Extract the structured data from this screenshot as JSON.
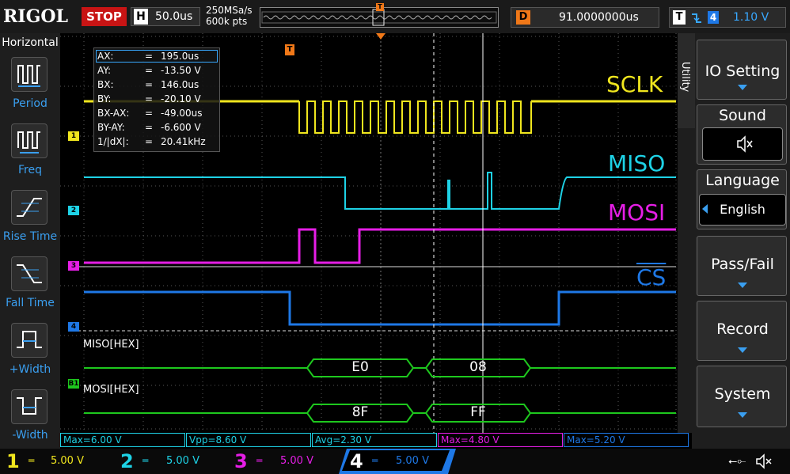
{
  "topbar": {
    "brand": "RIGOL",
    "run_state": "STOP",
    "horizontal_letter": "H",
    "timebase": "50.0us",
    "sample_rate": "250MSa/s",
    "memory_depth": "600k pts",
    "delay_letter": "D",
    "delay": "91.0000000us",
    "trigger_letter": "T",
    "trigger_channel": "4",
    "trigger_level": "1.10 V",
    "trigger_marker": "T"
  },
  "left_panel": {
    "title": "Horizontal",
    "items": [
      {
        "label": "Period",
        "icon": "period-icon"
      },
      {
        "label": "Freq",
        "icon": "freq-icon"
      },
      {
        "label": "Rise Time",
        "icon": "rise-time-icon"
      },
      {
        "label": "Fall Time",
        "icon": "fall-time-icon"
      },
      {
        "label": "+Width",
        "icon": "positive-width-icon"
      },
      {
        "label": "-Width",
        "icon": "negative-width-icon"
      }
    ]
  },
  "cursor_readout": {
    "rows": [
      {
        "name": "AX:",
        "value": "195.0us"
      },
      {
        "name": "AY:",
        "value": "-13.50 V"
      },
      {
        "name": "BX:",
        "value": "146.0us"
      },
      {
        "name": "BY:",
        "value": "-20.10 V"
      },
      {
        "name": "BX-AX:",
        "value": "-49.00us"
      },
      {
        "name": "BY-AY:",
        "value": "-6.600 V"
      },
      {
        "name": "1/|dX|:",
        "value": "20.41kHz"
      }
    ]
  },
  "channels": {
    "ch1": {
      "label": "SCLK",
      "marker": "1",
      "color": "#f0e61e"
    },
    "ch2": {
      "label": "MISO",
      "marker": "2",
      "color": "#1ed2e6"
    },
    "ch3": {
      "label": "MOSI",
      "marker": "3",
      "color": "#e61ee6"
    },
    "ch4": {
      "label": "CS",
      "marker": "4",
      "color": "#1e78e6"
    }
  },
  "decode": {
    "bus1_marker": "B1",
    "miso_label": "MISO[HEX]",
    "mosi_label": "MOSI[HEX]",
    "miso_values": [
      "E0",
      "08"
    ],
    "mosi_values": [
      "8F",
      "FF"
    ],
    "color": "#1ec81e"
  },
  "right_menu": {
    "tab": "Utility",
    "items": [
      {
        "label": "IO Setting",
        "has_arrow": true
      },
      {
        "label": "Sound",
        "value_icon": "speaker-muted-icon"
      },
      {
        "label": "Language",
        "value": "English"
      },
      {
        "label": "Pass/Fail",
        "has_arrow": true
      },
      {
        "label": "Record",
        "has_arrow": true
      },
      {
        "label": "System",
        "has_arrow": true
      }
    ]
  },
  "measurements": [
    {
      "text": "Max=6.00 V",
      "color": "#1ed2e6"
    },
    {
      "text": "Vpp=8.60 V",
      "color": "#1ed2e6"
    },
    {
      "text": "Avg=2.30 V",
      "color": "#1ed2e6"
    },
    {
      "text": "Max=4.80 V",
      "color": "#e61ee6"
    },
    {
      "text": "Max=5.20 V",
      "color": "#1e78e6"
    }
  ],
  "bottom_channels": [
    {
      "num": "1",
      "scale": "5.00 V",
      "color": "#f0e61e"
    },
    {
      "num": "2",
      "scale": "5.00 V",
      "color": "#1ed2e6"
    },
    {
      "num": "3",
      "scale": "5.00 V",
      "color": "#e61ee6"
    },
    {
      "num": "4",
      "scale": "5.00 V",
      "color": "#1e78e6"
    }
  ]
}
